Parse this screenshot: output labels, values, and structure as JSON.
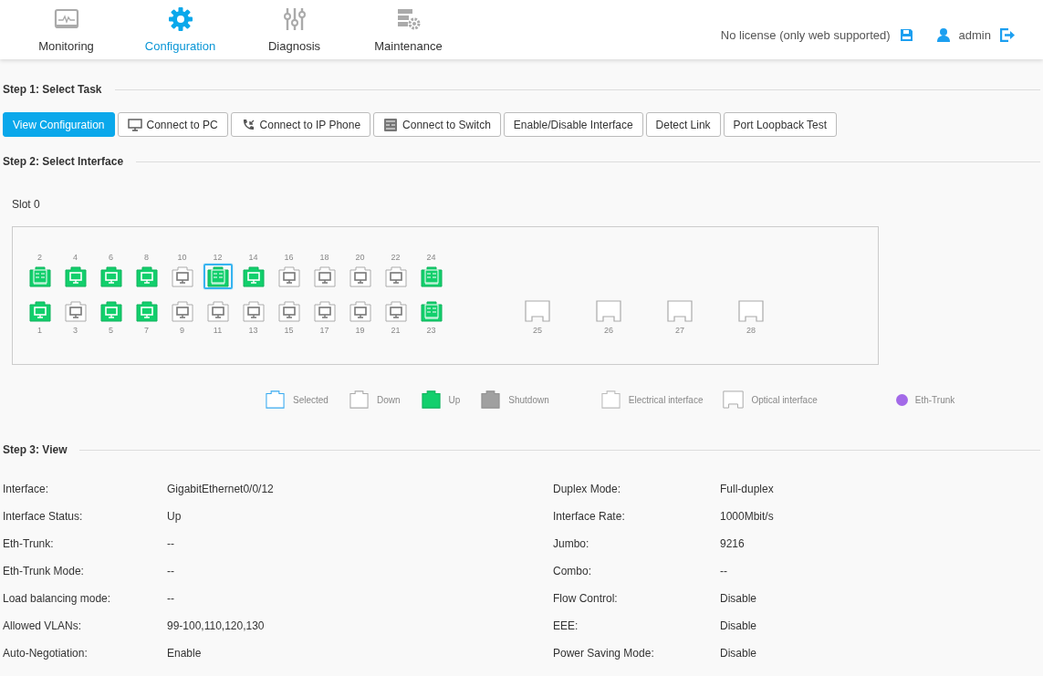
{
  "nav": [
    {
      "label": "Monitoring",
      "selected": false
    },
    {
      "label": "Configuration",
      "selected": true
    },
    {
      "label": "Diagnosis",
      "selected": false
    },
    {
      "label": "Maintenance",
      "selected": false
    }
  ],
  "header_right": {
    "license": "No license (only web supported)",
    "user": "admin"
  },
  "step1": {
    "title": "Step 1: Select Task",
    "tasks": [
      {
        "label": "View Configuration",
        "selected": true
      },
      {
        "label": "Connect to PC",
        "selected": false
      },
      {
        "label": "Connect to IP Phone",
        "selected": false
      },
      {
        "label": "Connect to Switch",
        "selected": false
      },
      {
        "label": "Enable/Disable Interface",
        "selected": false
      },
      {
        "label": "Detect Link",
        "selected": false
      },
      {
        "label": "Port Loopback Test",
        "selected": false
      }
    ]
  },
  "step2": {
    "title": "Step 2: Select Interface",
    "slot": "Slot 0",
    "top_ports": [
      {
        "number": "2",
        "up": true,
        "kind": "switch",
        "selected": false
      },
      {
        "number": "4",
        "up": true,
        "kind": "pc",
        "selected": false
      },
      {
        "number": "6",
        "up": true,
        "kind": "pc",
        "selected": false
      },
      {
        "number": "8",
        "up": true,
        "kind": "pc",
        "selected": false
      },
      {
        "number": "10",
        "up": false,
        "kind": "pc",
        "selected": false
      },
      {
        "number": "12",
        "up": true,
        "kind": "switch",
        "selected": true
      },
      {
        "number": "14",
        "up": true,
        "kind": "pc",
        "selected": false
      },
      {
        "number": "16",
        "up": false,
        "kind": "pc",
        "selected": false
      },
      {
        "number": "18",
        "up": false,
        "kind": "pc",
        "selected": false
      },
      {
        "number": "20",
        "up": false,
        "kind": "pc",
        "selected": false
      },
      {
        "number": "22",
        "up": false,
        "kind": "pc",
        "selected": false
      },
      {
        "number": "24",
        "up": true,
        "kind": "switch",
        "selected": false
      }
    ],
    "bottom_ports": [
      {
        "number": "1",
        "up": true,
        "kind": "pc",
        "selected": false
      },
      {
        "number": "3",
        "up": false,
        "kind": "pc",
        "selected": false
      },
      {
        "number": "5",
        "up": true,
        "kind": "pc",
        "selected": false
      },
      {
        "number": "7",
        "up": true,
        "kind": "pc",
        "selected": false
      },
      {
        "number": "9",
        "up": false,
        "kind": "pc",
        "selected": false
      },
      {
        "number": "11",
        "up": false,
        "kind": "pc",
        "selected": false
      },
      {
        "number": "13",
        "up": false,
        "kind": "pc",
        "selected": false
      },
      {
        "number": "15",
        "up": false,
        "kind": "pc",
        "selected": false
      },
      {
        "number": "17",
        "up": false,
        "kind": "pc",
        "selected": false
      },
      {
        "number": "19",
        "up": false,
        "kind": "pc",
        "selected": false
      },
      {
        "number": "21",
        "up": false,
        "kind": "pc",
        "selected": false
      },
      {
        "number": "23",
        "up": true,
        "kind": "switch",
        "selected": false
      }
    ],
    "optical_ports": [
      {
        "number": "25"
      },
      {
        "number": "26"
      },
      {
        "number": "27"
      },
      {
        "number": "28"
      }
    ],
    "legend": [
      {
        "kind": "selected",
        "label": "Selected"
      },
      {
        "kind": "down",
        "label": "Down"
      },
      {
        "kind": "up",
        "label": "Up"
      },
      {
        "kind": "shutdown",
        "label": "Shutdown"
      },
      {
        "kind": "electrical",
        "label": "Electrical interface"
      },
      {
        "kind": "optical",
        "label": "Optical interface"
      },
      {
        "kind": "trunk",
        "label": "Eth-Trunk",
        "color": "#a36ae8"
      }
    ]
  },
  "step3": {
    "title": "Step 3: View",
    "rows": [
      {
        "label": "Interface:",
        "value": "GigabitEthernet0/0/12",
        "label_2": "Duplex Mode:",
        "value_2": "Full-duplex"
      },
      {
        "label": "Interface Status:",
        "value": "Up",
        "label_2": "Interface Rate:",
        "value_2": "1000Mbit/s"
      },
      {
        "label": "Eth-Trunk:",
        "value": "--",
        "label_2": "Jumbo:",
        "value_2": "9216"
      },
      {
        "label": "Eth-Trunk Mode:",
        "value": "--",
        "label_2": "Combo:",
        "value_2": "--"
      },
      {
        "label": "Load balancing mode:",
        "value": "--",
        "label_2": "Flow Control:",
        "value_2": "Disable"
      },
      {
        "label": "Allowed VLANs:",
        "value": "99-100,110,120,130",
        "label_2": "EEE:",
        "value_2": "Disable"
      },
      {
        "label": "Auto-Negotiation:",
        "value": "Enable",
        "label_2": "Power Saving Mode:",
        "value_2": "Disable"
      }
    ]
  }
}
